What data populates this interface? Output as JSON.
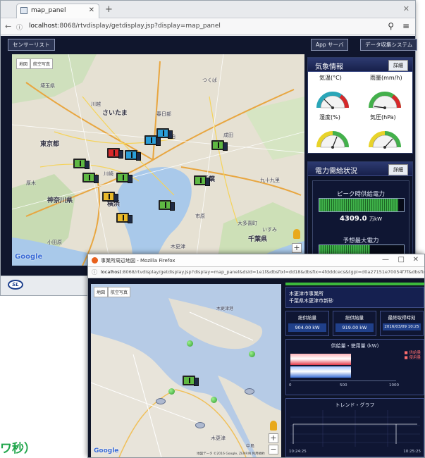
{
  "window1": {
    "tab_title": "map_panel",
    "url_host": "localhost",
    "url_rest": ":8068/rtvdisplay/getdisplay.jsp?display=map_panel",
    "sensor_list_label": "センサーリスト",
    "app_server_label": "App サーバ",
    "data_system_label": "データ収集システム",
    "map_type_map": "地図",
    "map_type_satellite": "航空写真",
    "google_label": "Google",
    "cities": [
      "埼玉県",
      "さいたま",
      "川越",
      "東京都",
      "神奈川県",
      "横浜",
      "千葉",
      "成田",
      "つくば",
      "九十九里",
      "大多喜町",
      "千葉県",
      "小田原",
      "川崎",
      "柏",
      "いすみ",
      "木更津",
      "市原",
      "厚木",
      "春日部"
    ],
    "weather": {
      "title": "気象情報",
      "detail_label": "詳細",
      "gauges": [
        {
          "label": "気温(°C)"
        },
        {
          "label": "雨量(mm/h)"
        },
        {
          "label": "湿度(%)"
        },
        {
          "label": "気圧(hPa)"
        }
      ]
    },
    "power": {
      "title": "電力需給状況",
      "detail_label": "詳細",
      "peak_label": "ピーク時供給電力",
      "peak_value": "4309.0",
      "peak_unit": "万kW",
      "forecast_label": "予想最大電力",
      "peak_fill": 0.93,
      "forecast_fill": 0.6
    }
  },
  "window2": {
    "title": "事業所周辺地図 - Mozilla Firefox",
    "url_host": "localhost",
    "url_rest": ":8068/rtvdisplay/getdisplay.jsp?display=map_panel&dsId=1e1f&dbsfixl=dd18&dbsfix=4fdddcecs&tgpI=d0a27151e70054f7f&dbsfix",
    "map_type_map": "地図",
    "map_type_satellite": "航空写真",
    "google_label": "Google",
    "map_copyright": "地図データ ©2016 Google, ZENRIN 利用規約",
    "office_name": "木更津市事業所",
    "office_address": "千葉県木更津市新砂",
    "kpis": [
      {
        "label": "総供給量",
        "value": "904.00 kW"
      },
      {
        "label": "総供給量",
        "value": "919.00 kW"
      },
      {
        "label": "最終取得時刻",
        "value": "2016/03/09 10:25"
      }
    ],
    "bar_chart_title": "供給量・使用量 (kW)",
    "legend": [
      "■ 供給量",
      "■ 使用量"
    ],
    "trend_title": "トレンド・グラフ",
    "trend_times": [
      "10:24:25",
      "10:25:25"
    ],
    "map_labels": [
      "木更津",
      "木更津港",
      "中島"
    ],
    "chart_ticks": [
      "0",
      "500",
      "1000"
    ]
  },
  "bottom_label": "ワ秒）"
}
